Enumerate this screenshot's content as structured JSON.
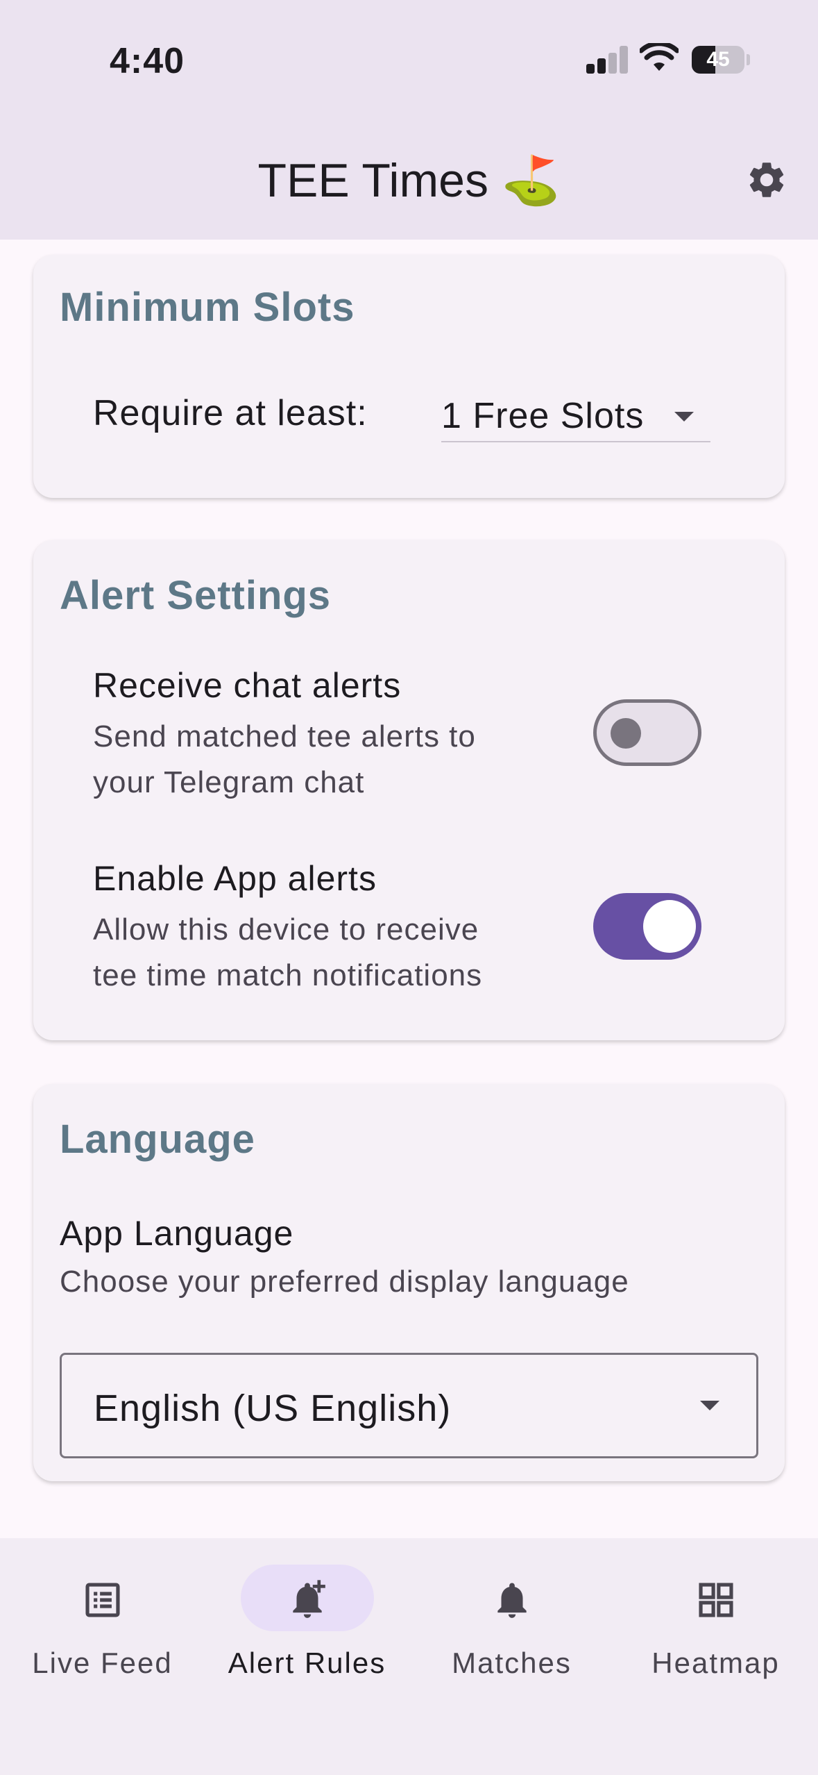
{
  "status": {
    "time": "4:40",
    "battery": "45",
    "battery_level": 0.45
  },
  "appbar": {
    "title": "TEE Times",
    "title_emoji": "⛳",
    "settings_icon": "gear-icon"
  },
  "min_slots": {
    "title": "Minimum Slots",
    "require_label": "Require at least:",
    "selected": "1 Free Slots"
  },
  "alert_settings": {
    "title": "Alert Settings",
    "chat": {
      "label": "Receive chat alerts",
      "desc_line1": "Send matched tee alerts to",
      "desc_line2": "your Telegram chat",
      "enabled": false
    },
    "app": {
      "label": "Enable App alerts",
      "desc_line1": "Allow this device to receive",
      "desc_line2": "tee time match notifications",
      "enabled": true
    }
  },
  "language": {
    "title": "Language",
    "label": "App Language",
    "desc": "Choose your preferred display language",
    "selected": "English (US English)"
  },
  "nav": {
    "items": [
      {
        "label": "Live Feed",
        "icon": "list-icon"
      },
      {
        "label": "Alert Rules",
        "icon": "bell-plus-icon",
        "active": true
      },
      {
        "label": "Matches",
        "icon": "bell-icon"
      },
      {
        "label": "Heatmap",
        "icon": "grid-icon"
      }
    ]
  },
  "colors": {
    "accent": "#6750a4",
    "card_title": "#5d7887",
    "appbar": "#ebe3f0"
  }
}
